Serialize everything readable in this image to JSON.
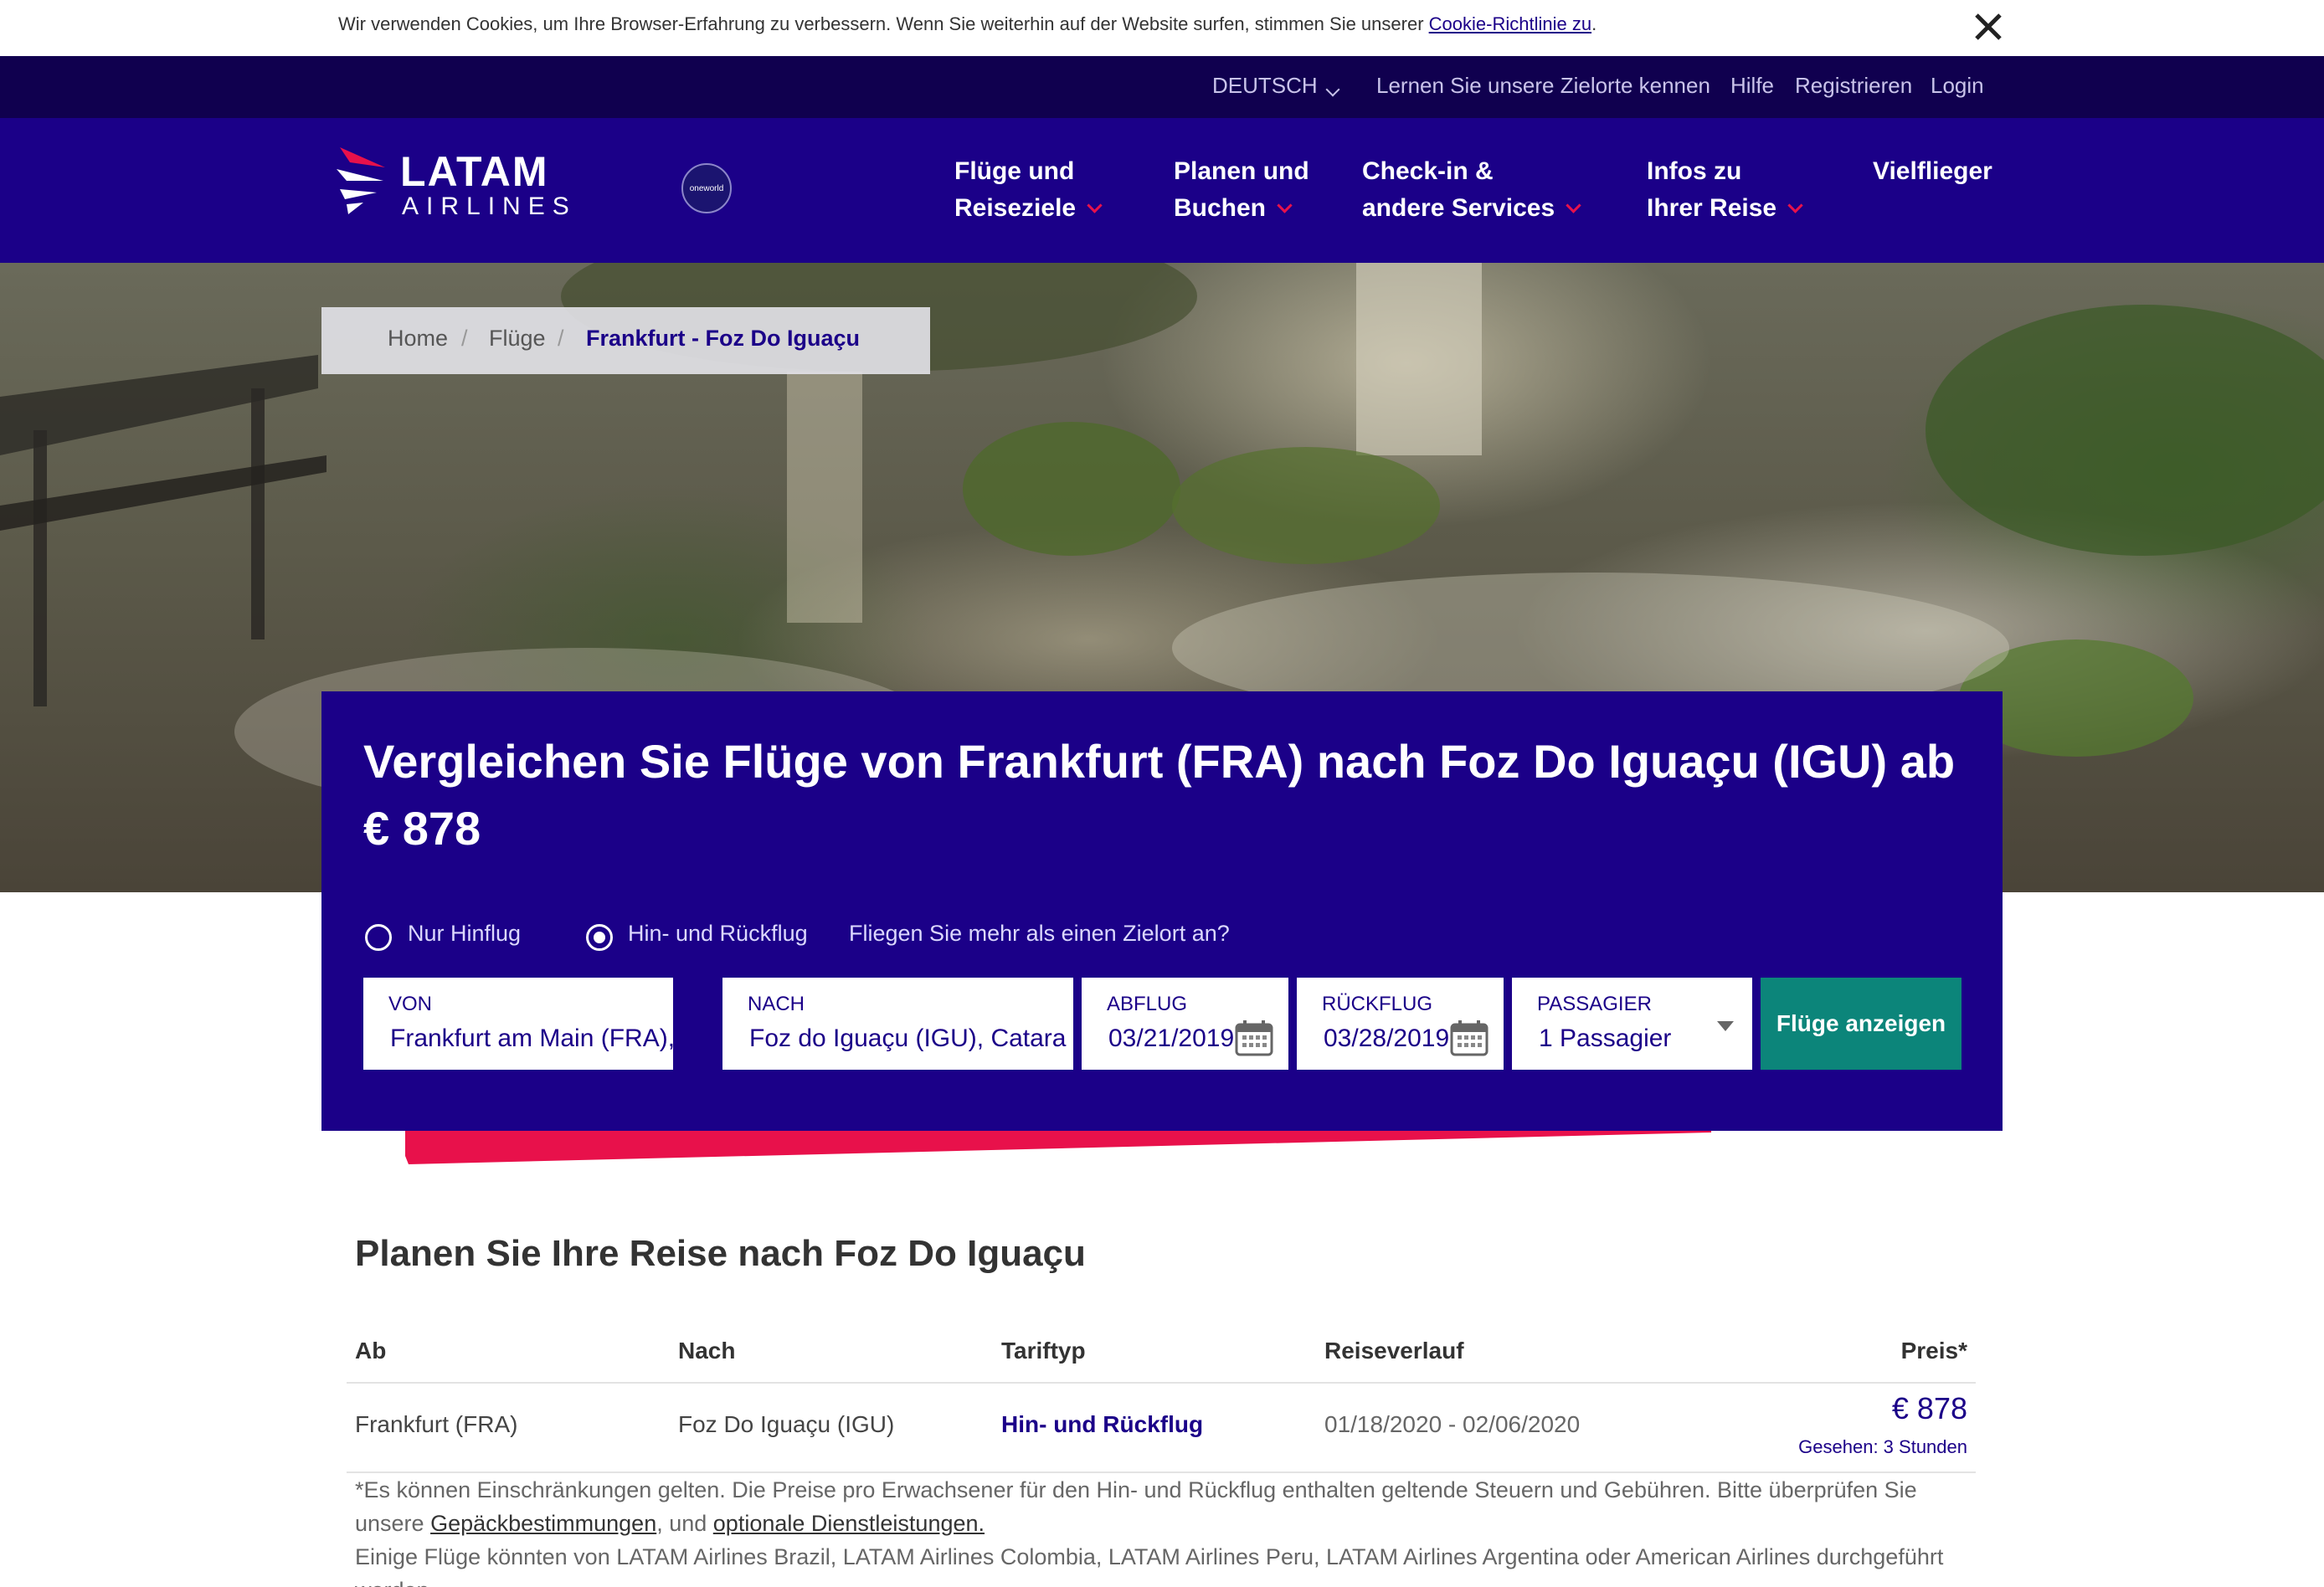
{
  "cookie": {
    "text": "Wir verwenden Cookies, um Ihre Browser-Erfahrung zu verbessern. Wenn Sie weiterhin auf der Website surfen, stimmen Sie unserer ",
    "link": "Cookie-Richtlinie zu",
    "suffix": "."
  },
  "top_bar": {
    "language": "DEUTSCH",
    "links": [
      "Lernen Sie unsere Zielorte kennen",
      "Hilfe",
      "Registrieren",
      "Login"
    ]
  },
  "logo": {
    "line1": "LATAM",
    "line2": "AIRLINES",
    "alliance": "oneworld"
  },
  "nav": [
    {
      "line1": "Flüge und",
      "line2": "Reiseziele"
    },
    {
      "line1": "Planen und",
      "line2": "Buchen"
    },
    {
      "line1": "Check-in &",
      "line2": "andere Services"
    },
    {
      "line1": "Infos zu",
      "line2": "Ihrer Reise"
    },
    {
      "line1": "Vielflieger",
      "line2": ""
    }
  ],
  "breadcrumb": [
    "Home",
    "Flüge",
    "Frankfurt - Foz Do Iguaçu"
  ],
  "search": {
    "title": "Vergleichen Sie Flüge von Frankfurt (FRA) nach Foz Do Iguaçu (IGU) ab € 878",
    "trip_types": [
      "Nur Hinflug",
      "Hin- und Rückflug"
    ],
    "selected_trip_type": "Hin- und Rückflug",
    "multi_city": "Fliegen Sie mehr als einen Zielort an?",
    "fields": {
      "from": {
        "label": "VON",
        "value": "Frankfurt am Main (FRA), F"
      },
      "to": {
        "label": "NACH",
        "value": "Foz do Iguaçu (IGU), Catara"
      },
      "depart": {
        "label": "ABFLUG",
        "value": "03/21/2019"
      },
      "return": {
        "label": "RÜCKFLUG",
        "value": "03/28/2019"
      },
      "passengers": {
        "label": "PASSAGIER",
        "value": "1 Passagier"
      }
    },
    "submit": "Flüge anzeigen"
  },
  "plan": {
    "title": "Planen Sie Ihre Reise nach Foz Do Iguaçu",
    "headers": [
      "Ab",
      "Nach",
      "Tariftyp",
      "Reiseverlauf",
      "Preis*"
    ],
    "rows": [
      {
        "from": "Frankfurt (FRA)",
        "to": "Foz Do Iguaçu (IGU)",
        "fare_type": "Hin- und Rückflug",
        "itinerary": "01/18/2020 - 02/06/2020",
        "price": "€ 878",
        "seen": "Gesehen: 3 Stunden"
      }
    ],
    "footnote": {
      "part1": "*Es können Einschränkungen gelten. Die Preise pro Erwachsener für den Hin- und Rückflug enthalten geltende Steuern und Gebühren. Bitte überprüfen Sie unsere ",
      "link1": "Gepäckbestimmungen",
      "part2": ", und ",
      "link2": "optionale Dienstleistungen.",
      "line2": "Einige Flüge könnten von LATAM Airlines Brazil, LATAM Airlines Colombia, LATAM Airlines Peru, LATAM Airlines Argentina oder American Airlines durchgeführt werden."
    }
  },
  "colors": {
    "brand_indigo": "#1b0088",
    "top_bar": "#10004f",
    "accent_red": "#e8114b",
    "button_teal": "#0c857a"
  }
}
